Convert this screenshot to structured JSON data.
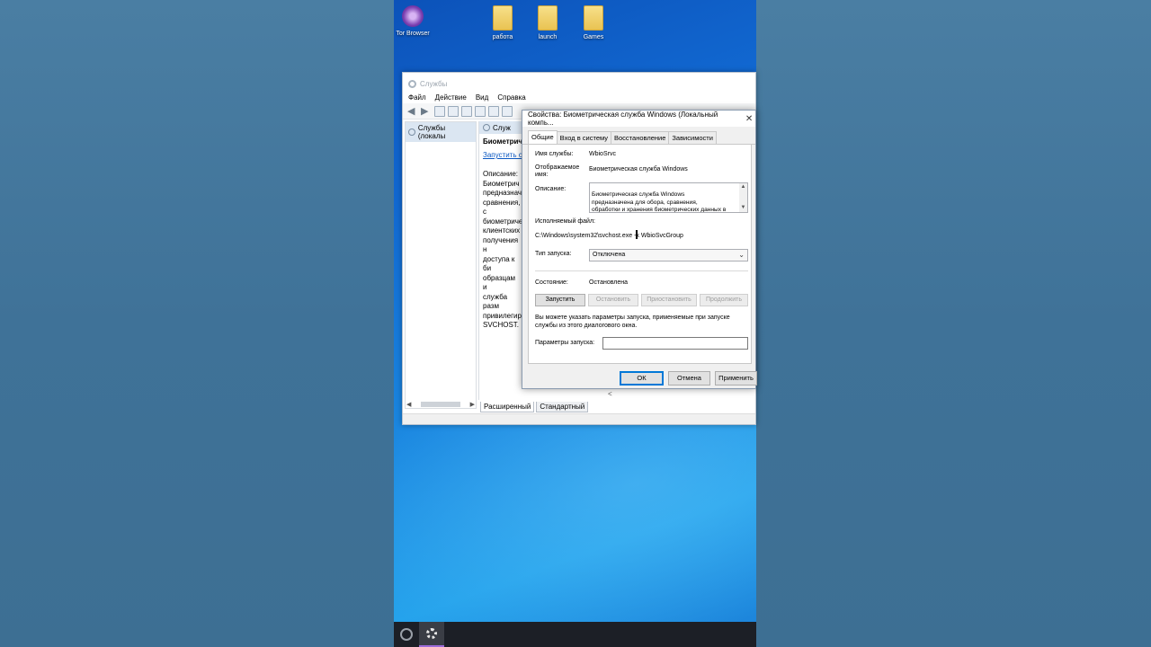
{
  "desktop": {
    "icons": [
      {
        "label": "Tor Browser",
        "icon": "tor-browser-icon"
      },
      {
        "label": "работа",
        "icon": "file-icon"
      },
      {
        "label": "launch",
        "icon": "file-icon"
      },
      {
        "label": "Games",
        "icon": "folder-icon"
      }
    ]
  },
  "services_window": {
    "title": "Службы",
    "menu": [
      "Файл",
      "Действие",
      "Вид",
      "Справка"
    ],
    "tree_item": "Службы (локалы",
    "detail_header": "Служ",
    "detail_name": "Биометрич",
    "detail_link": "Запустить с",
    "detail_description": "Описание:\nБиометрич\nпредназнач\nсравнения, с\nбиометричес\nклиентских\nполучения н\nдоступа к би\nобразцам и\nслужба разм\nпривилегир\nSVCHOST.",
    "view_tabs": [
      "Расширенный",
      "Стандартный"
    ]
  },
  "properties_dialog": {
    "title": "Свойства: Биометрическая служба Windows (Локальный компь...",
    "tabs": [
      "Общие",
      "Вход в систему",
      "Восстановление",
      "Зависимости"
    ],
    "service_name_label": "Имя службы:",
    "service_name_value": "WbioSrvc",
    "display_name_label": "Отображаемое\nимя:",
    "display_name_value": "Биометрическая служба Windows",
    "description_label": "Описание:",
    "description_value": "Биометрическая служба Windows\nпредназначена для обора, сравнения,\nобработки и хранения биометрических данных в\nклиентских приложениях без получения",
    "exec_file_label": "Исполняемый файл:",
    "exec_file_value": "C:\\Windows\\system32\\svchost.exe -k WbioSvcGroup",
    "startup_type_label": "Тип запуска:",
    "startup_type_value": "Отключена",
    "status_label": "Состояние:",
    "status_value": "Остановлена",
    "buttons": {
      "start": "Запустить",
      "stop": "Остановить",
      "pause": "Приостановить",
      "resume": "Продолжить"
    },
    "hint": "Вы можете указать параметры запуска, применяемые при запуске службы из этого диалогового окна.",
    "params_label": "Параметры запуска:",
    "params_value": "",
    "ok": "ОК",
    "cancel": "Отмена",
    "apply": "Применить"
  }
}
